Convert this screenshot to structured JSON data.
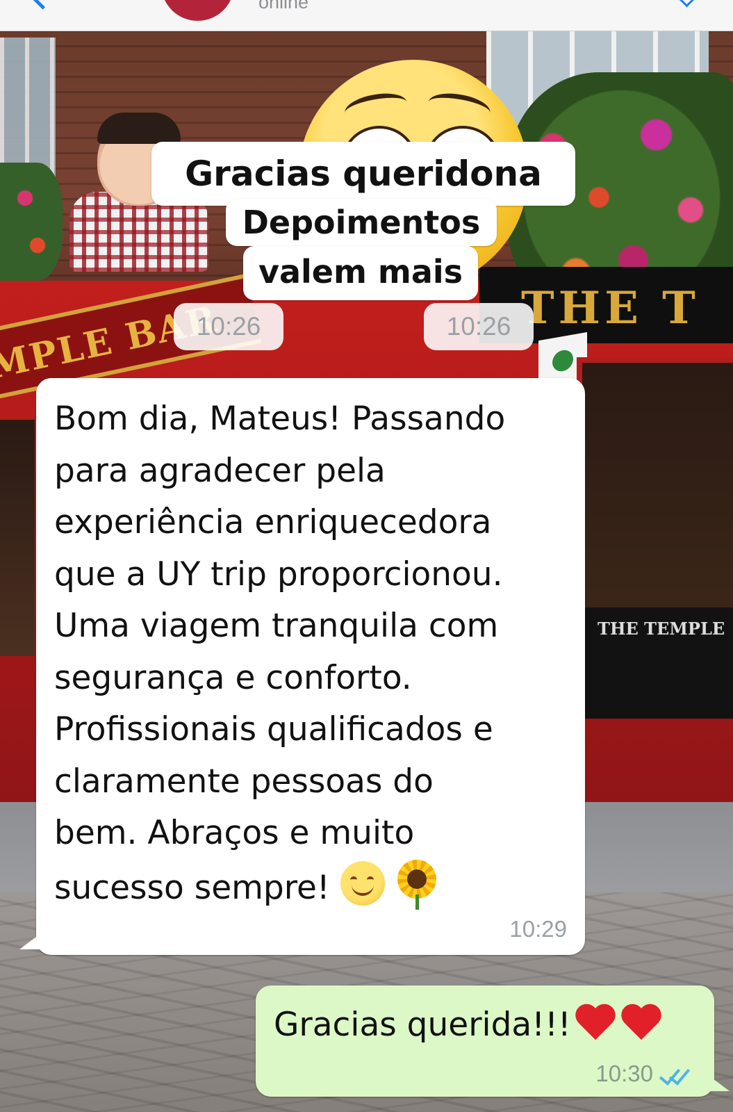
{
  "header": {
    "contact_status": "online"
  },
  "background": {
    "sign_left": "MPLE BAR",
    "sign_right": "THE T",
    "board_text": "THE TEMPLE"
  },
  "sticker": {
    "caption_line1": "Gracias queridona",
    "caption_line2": "Depoimentos",
    "caption_line3": "valem mais",
    "times": [
      "10:26",
      "10:26"
    ]
  },
  "messages": {
    "incoming": {
      "text": "Bom dia, Mateus! Passando\npara agradecer pela\nexperiência enriquecedora\nque a UY trip proporcionou.\nUma viagem tranquila com\nsegurança e conforto.\nProfissionais qualificados e\nclaramente pessoas do\nbem. Abraços e muito\nsucesso sempre!",
      "time": "10:29",
      "emoji": [
        "smiling-face-emoji",
        "sunflower-emoji"
      ]
    },
    "outgoing": {
      "text": "Gracias querida!!!",
      "time": "10:30",
      "emoji": [
        "red-heart-emoji",
        "red-heart-emoji"
      ],
      "status": "read"
    }
  },
  "colors": {
    "incoming_bubble": "#ffffff",
    "outgoing_bubble": "#dcf8c6",
    "read_ticks": "#4fb3e8",
    "accent": "#1f7ef0"
  }
}
